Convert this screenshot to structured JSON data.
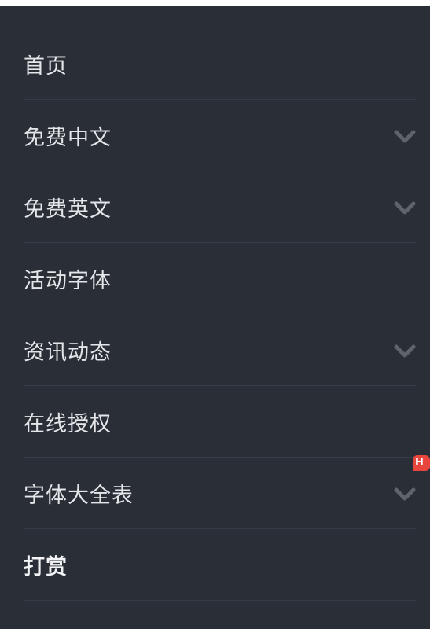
{
  "menu": {
    "items": [
      {
        "label": "首页",
        "has_submenu": false
      },
      {
        "label": "免费中文",
        "has_submenu": true
      },
      {
        "label": "免费英文",
        "has_submenu": true
      },
      {
        "label": "活动字体",
        "has_submenu": false
      },
      {
        "label": "资讯动态",
        "has_submenu": true
      },
      {
        "label": "在线授权",
        "has_submenu": false
      },
      {
        "label": "字体大全表",
        "has_submenu": true,
        "badge": "H"
      },
      {
        "label": "打赏",
        "has_submenu": false,
        "bold": true
      }
    ],
    "chevron_icon": "chevron-down-icon"
  },
  "colors": {
    "panel_bg": "#2a2f37",
    "divider": "#363c45",
    "text": "#e4e6e9",
    "chevron": "#5f646b",
    "badge": "#e8453c"
  }
}
